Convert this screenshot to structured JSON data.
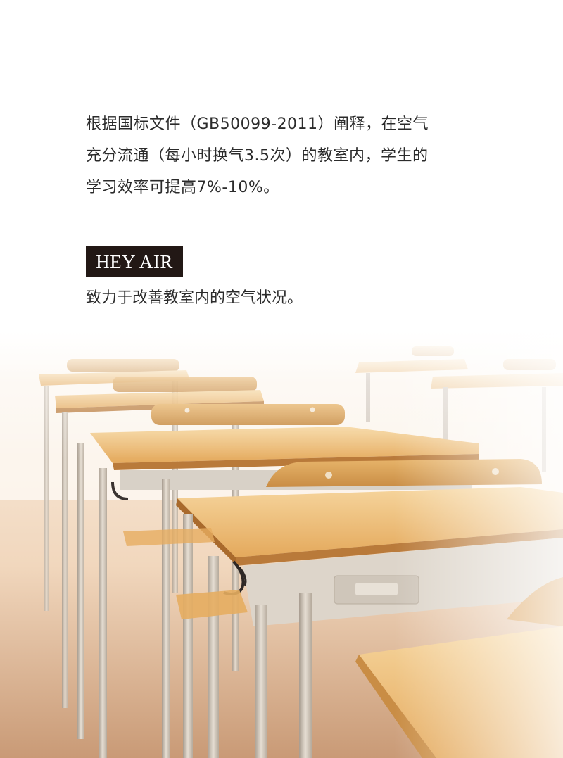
{
  "intro": {
    "lines": [
      "根据国标文件（GB50099-2011）阐释，在空气",
      "充分流通（每小时换气3.5次）的教室内，学生的",
      "学习效率可提高7%-10%。"
    ]
  },
  "badge": {
    "label": "HEY AIR"
  },
  "tagline": "致力于改善教室内的空气状况。",
  "colors": {
    "text": "#2b2b2b",
    "badge_bg": "#221815",
    "badge_text": "#ffffff",
    "desk_wood": "#e9b268",
    "desk_edge": "#b97a3a",
    "metal": "#c9c0b4"
  }
}
